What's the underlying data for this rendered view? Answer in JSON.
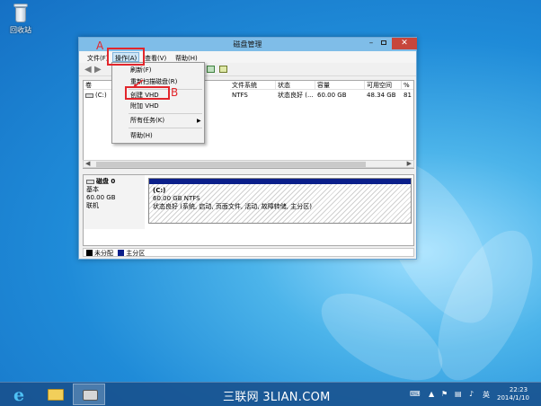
{
  "desktop": {
    "recycle_bin_label": "回收站"
  },
  "window": {
    "title": "磁盘管理",
    "menu": [
      {
        "label": "文件(F)"
      },
      {
        "label": "操作(A)",
        "active": true
      },
      {
        "label": "查看(V)"
      },
      {
        "label": "帮助(H)"
      }
    ],
    "volume_table": {
      "headers": [
        "卷",
        "布局",
        "类型",
        "文件系统",
        "状态",
        "容量",
        "可用空间",
        "%"
      ],
      "rows": [
        {
          "volume": "(C:)",
          "file_system": "NTFS",
          "status": "状态良好 (...",
          "capacity": "60.00 GB",
          "free": "48.34 GB",
          "percent": "81"
        }
      ]
    },
    "disk": {
      "name": "磁盘 0",
      "type": "基本",
      "size": "60.00 GB",
      "state": "联机",
      "partition": {
        "name": "(C:)",
        "size_fs": "60.00 GB NTFS",
        "status": "状态良好 (系统, 启动, 页面文件, 活动, 故障转储, 主分区)"
      }
    },
    "legend": [
      {
        "label": "未分配",
        "color": "#000000"
      },
      {
        "label": "主分区",
        "color": "#0b1f8a"
      }
    ]
  },
  "action_menu": {
    "items": [
      {
        "label": "刷新(F)"
      },
      {
        "label": "重新扫描磁盘(R)"
      },
      {
        "label": "创建 VHD"
      },
      {
        "label": "附加 VHD"
      },
      {
        "label": "所有任务(K)",
        "submenu": true
      },
      {
        "label": "帮助(H)"
      }
    ]
  },
  "annotations": {
    "a": "A",
    "b": "B",
    "color": "#e2262c"
  },
  "taskbar": {
    "watermark": "三联网 3LIAN.COM",
    "ime": "英",
    "time": "22:23",
    "date": "2014/1/10"
  },
  "icons": [
    "recycle-bin-icon",
    "drive-icon",
    "ie-icon",
    "folder-icon",
    "printer-icon",
    "keyboard-icon",
    "flag-icon",
    "network-icon",
    "speaker-icon"
  ]
}
